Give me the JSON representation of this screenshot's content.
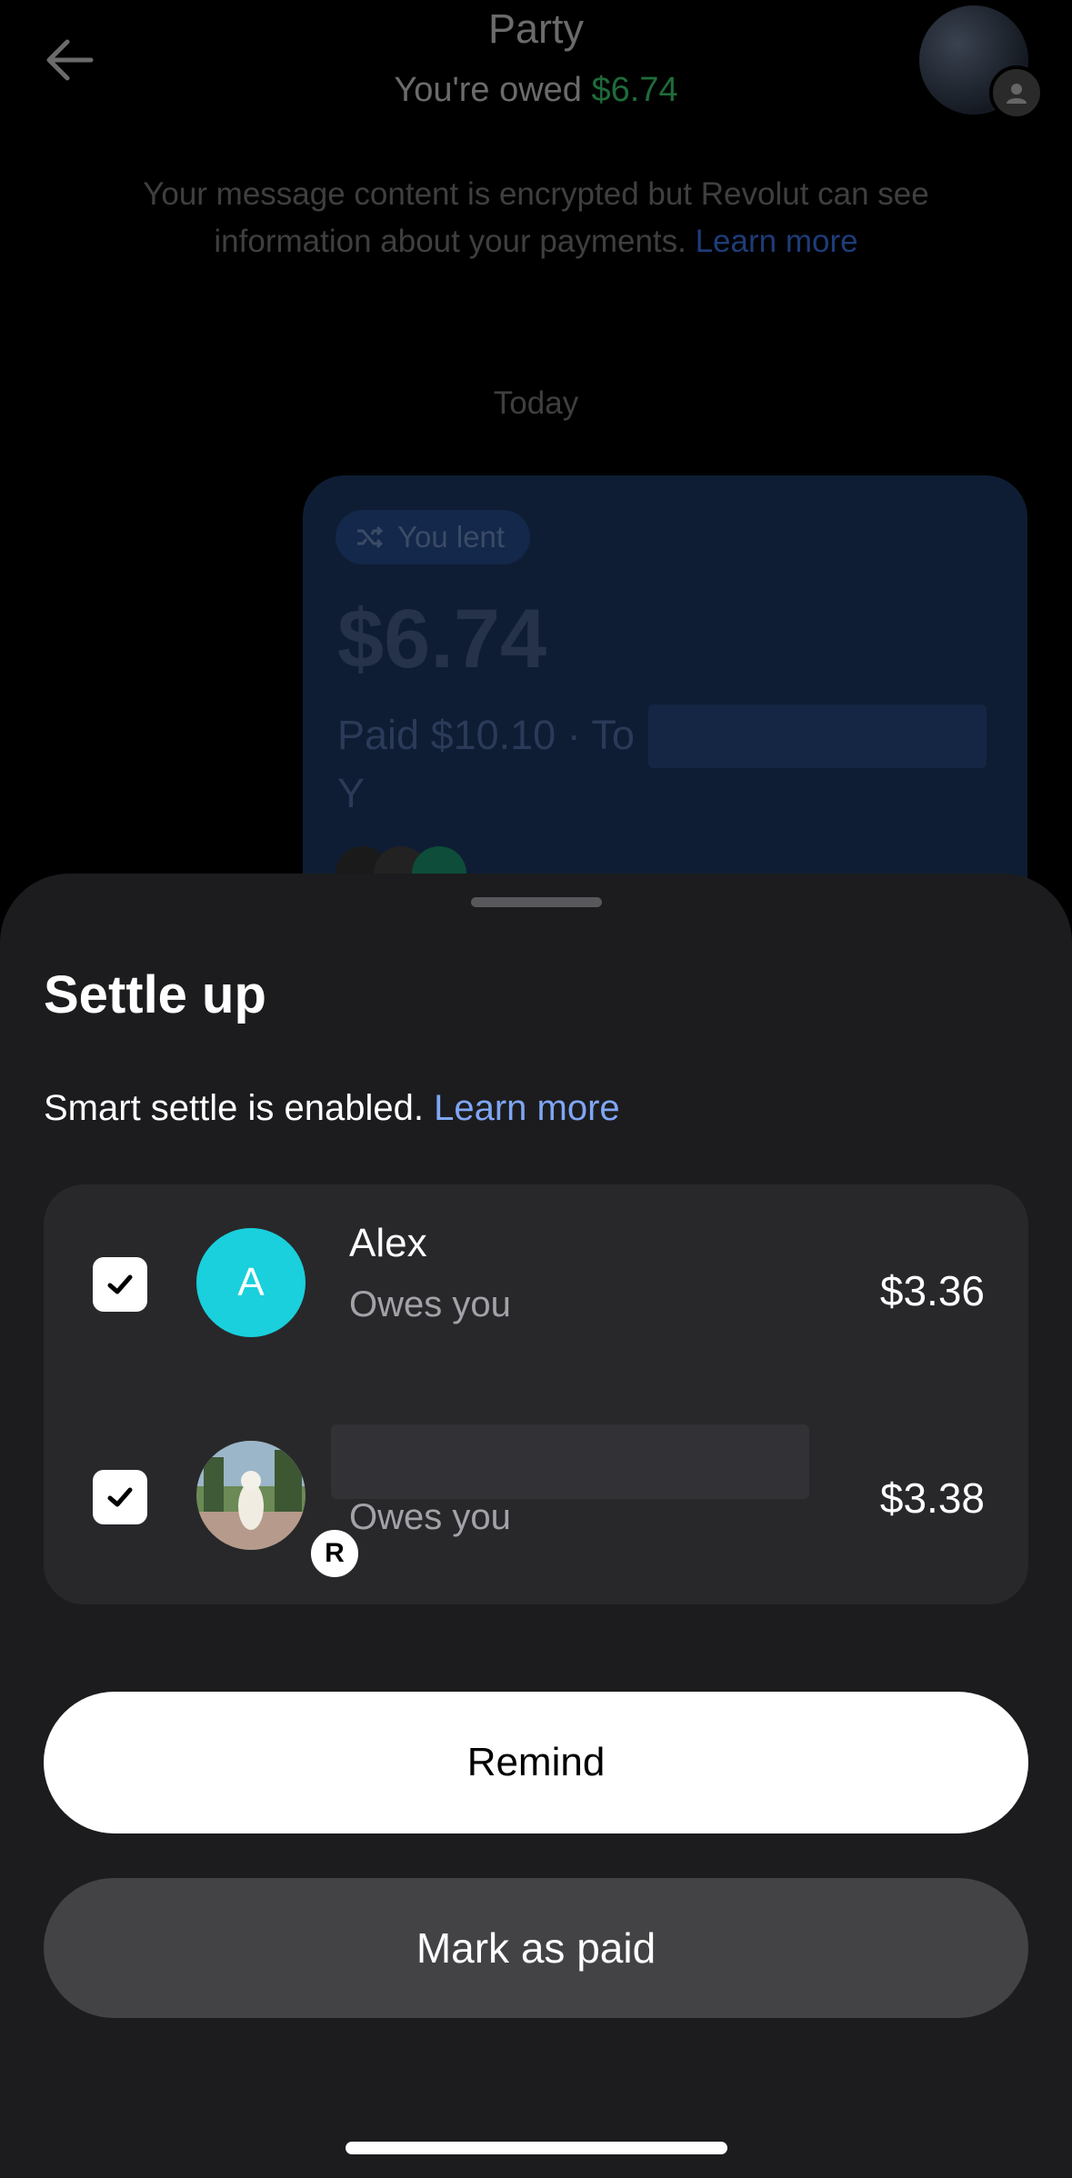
{
  "chat": {
    "title": "Party",
    "owed_prefix": "You're owed ",
    "owed_amount": "$6.74",
    "encryption_note": "Your message content is encrypted but Revolut can see information about your payments.",
    "learn_more": "Learn more",
    "date_separator": "Today"
  },
  "lent_card": {
    "badge": "You lent",
    "amount": "$6.74",
    "paid_line": "Paid $10.10 · To",
    "paid_suffix": "Y"
  },
  "sheet": {
    "title": "Settle up",
    "description": "Smart settle is enabled.",
    "learn_more": "Learn more",
    "rows": [
      {
        "name": "Alex",
        "avatar_initial": "A",
        "status": "Owes you",
        "amount": "$3.36",
        "checked": true
      },
      {
        "name": "",
        "status": "Owes you",
        "amount": "$3.38",
        "checked": true
      }
    ],
    "remind_label": "Remind",
    "mark_paid_label": "Mark as paid"
  },
  "colors": {
    "accent_green": "#1f6b3a",
    "link_blue": "#7fa6f5",
    "avatar_cyan": "#19d0dc",
    "sheet_bg": "#1c1c1e"
  },
  "icons": [
    "back-arrow-icon",
    "group-icon",
    "split-icon",
    "check-icon",
    "revolut-r-icon"
  ]
}
